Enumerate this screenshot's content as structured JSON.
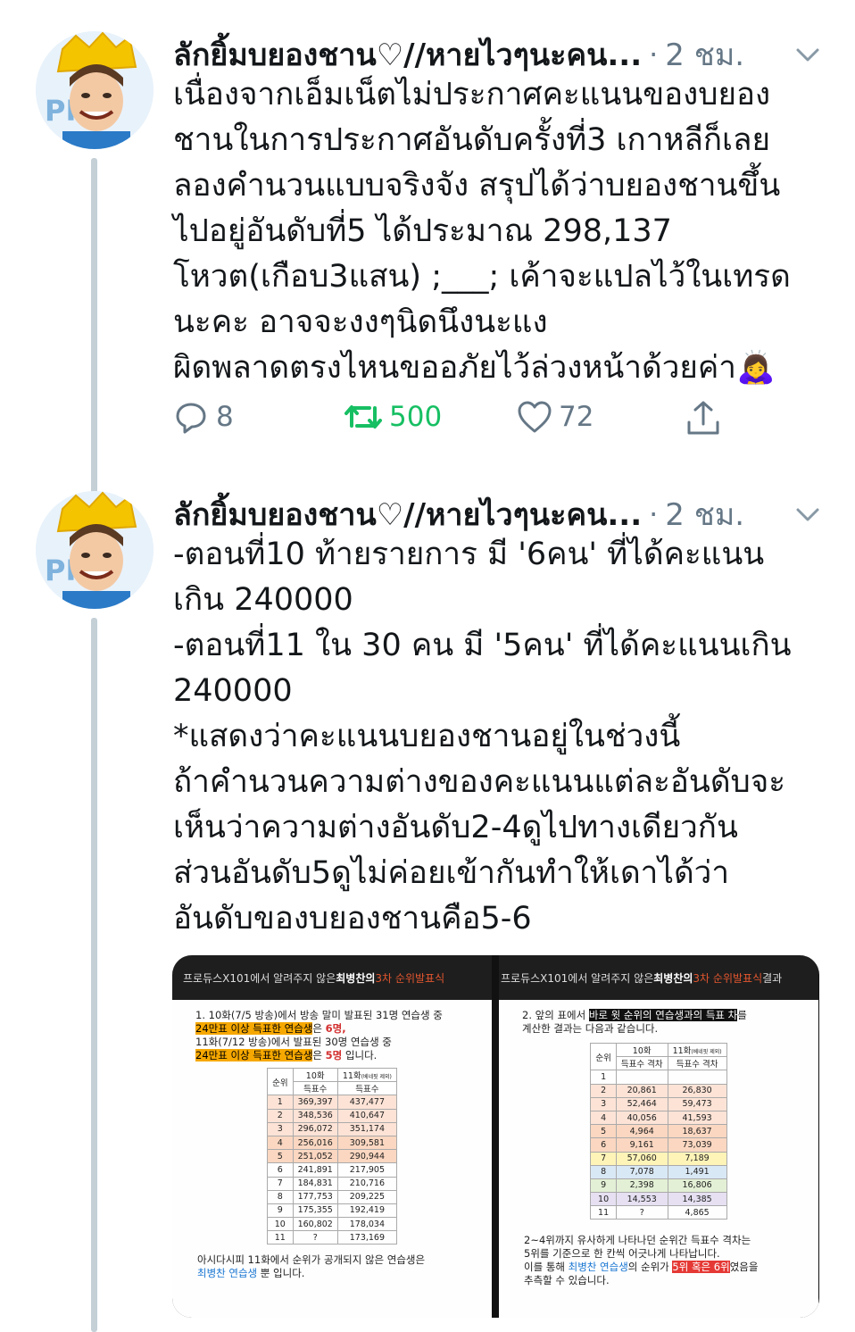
{
  "tweets": [
    {
      "name": "ลักยิ้มบยองชาน♡//หายไวๆนะคน...",
      "separator": "·",
      "time": "2 ชม.",
      "lines": [
        "เนื่องจากเอ็มเน็ตไม่ประกาศคะแนนของบยอง",
        "ชานในการประกาศอันดับครั้งที่3 เกาหลีก็เลย",
        "ลองคำนวนแบบจริงจัง สรุปได้ว่าบยองชานขึ้น",
        "ไปอยู่อันดับที่5 ได้ประมาณ 298,137",
        "โหวต(เกือบ3แสน) ;___; เค้าจะแปลไว้ในเทรด",
        "นะคะ อาจจะงงๆนิดนึงนะแง",
        "ผิดพลาดตรงไหนขออภัยไว้ล่วงหน้าด้วยค่า🙇‍♀️"
      ],
      "replies": "8",
      "retweets": "500",
      "likes": "72"
    },
    {
      "name": "ลักยิ้มบยองชาน♡//หายไวๆนะคน...",
      "separator": "·",
      "time": "2 ชม.",
      "lines": [
        "-ตอนที่10 ท้ายรายการ มี '6คน' ที่ได้คะแนน",
        "เกิน 240000",
        "-ตอนที่11 ใน 30 คน มี '5คน' ที่ได้คะแนนเกิน",
        "240000",
        "*แสดงว่าคะแนนบยองชานอยู่ในช่วงนี้",
        "ถ้าคำนวนความต่างของคะแนนแต่ละอันดับจะ",
        "เห็นว่าความต่างอันดับ2-4ดูไปทางเดียวกัน",
        "ส่วนอันดับ5ดูไม่ค่อยเข้ากันทำให้เดาได้ว่า",
        "อันดับของบยองชานคือ5-6"
      ]
    }
  ],
  "slide1": {
    "header_a": "프로듀스X101에서 알려주지 않은 ",
    "header_b": "최병찬의 ",
    "header_c": "3차 순위발표식",
    "l1": "1. 10화(7/5 방송)에서 방송 말미 발표된 31명 연습생 중",
    "l2a": "24만표 이상 득표한 연습생",
    "l2b": "은 ",
    "l2c": "6명,",
    "l3": "11화(7/12 방송)에서 발표된 30명 연습생 중",
    "l4a": "24만표 이상 득표한 연습생",
    "l4b": "은 ",
    "l4c": "5명",
    "l4d": " 입니다.",
    "col_rank": "순위",
    "col_ep10": "10화",
    "col_ep11": "11화",
    "col_ep11_note": "(베네핏 제외)",
    "col_votes": "득표수",
    "rows": [
      [
        "1",
        "369,397",
        "437,477"
      ],
      [
        "2",
        "348,536",
        "410,647"
      ],
      [
        "3",
        "296,072",
        "351,174"
      ],
      [
        "4",
        "256,016",
        "309,581"
      ],
      [
        "5",
        "251,052",
        "290,944"
      ],
      [
        "6",
        "241,891",
        "217,905"
      ],
      [
        "7",
        "184,831",
        "210,716"
      ],
      [
        "8",
        "177,753",
        "209,225"
      ],
      [
        "9",
        "175,355",
        "192,419"
      ],
      [
        "10",
        "160,802",
        "178,034"
      ],
      [
        "11",
        "?",
        "173,169"
      ]
    ],
    "note_a": "아시다시피 11화에서 순위가 공개되지 않은 연습생은",
    "note_b": "최병찬 연습생",
    "note_c": " 뿐 입니다."
  },
  "slide2": {
    "header_a": "프로듀스X101에서 알려주지 않은 ",
    "header_b": "최병찬의 ",
    "header_c": "3차 순위발표식",
    "header_d": " 결과",
    "l1a": "2. 앞의 표에서 ",
    "l1b": "바로 윗 순위의 연습생과의 득표 차",
    "l1c": "를",
    "l2": "계산한 결과는 다음과 같습니다.",
    "col_rank": "순위",
    "col_ep10": "10화",
    "col_ep11": "11화",
    "col_ep11_note": "(베네핏 제외)",
    "col_gap": "득표수 격차",
    "rows": [
      [
        "1",
        "",
        ""
      ],
      [
        "2",
        "20,861",
        "26,830"
      ],
      [
        "3",
        "52,464",
        "59,473"
      ],
      [
        "4",
        "40,056",
        "41,593"
      ],
      [
        "5",
        "4,964",
        "18,637"
      ],
      [
        "6",
        "9,161",
        "73,039"
      ],
      [
        "7",
        "57,060",
        "7,189"
      ],
      [
        "8",
        "7,078",
        "1,491"
      ],
      [
        "9",
        "2,398",
        "16,806"
      ],
      [
        "10",
        "14,553",
        "14,385"
      ],
      [
        "11",
        "?",
        "4,865"
      ]
    ],
    "n1": "2~4위까지 유사하게 나타나던 순위간 득표수 격차는",
    "n2": "5위를 기준으로 한 칸씩 어긋나게 나타납니다.",
    "n3a": "이를 통해 ",
    "n3b": "최병찬 연습생",
    "n3c": "의 순위가 ",
    "n3d": "5위 혹은 6위",
    "n3e": "였음을",
    "n4": "추측할 수 있습니다."
  },
  "colors": {
    "retweet_green": "#17bf63",
    "muted": "#657786",
    "thread_line": "#c4cfd6"
  }
}
